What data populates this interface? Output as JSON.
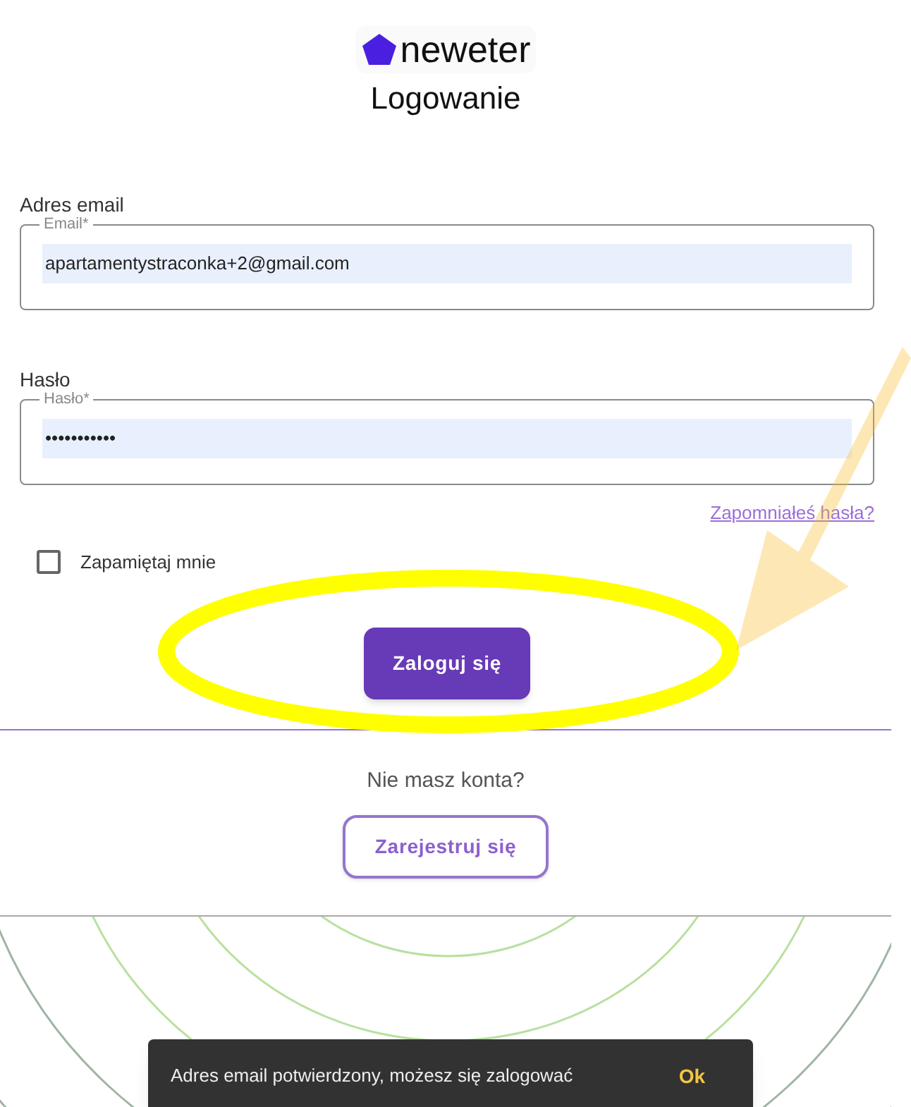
{
  "logo": {
    "text": "neweter"
  },
  "title": "Logowanie",
  "email": {
    "label": "Adres email",
    "floating_label": "Email*",
    "value": "apartamentystraconka+2@gmail.com"
  },
  "password": {
    "label": "Hasło",
    "floating_label": "Hasło*",
    "value": "•••••••••••"
  },
  "forgot_link": "Zapomniałeś hasła?",
  "remember": {
    "label": "Zapamiętaj mnie",
    "checked": false
  },
  "login_button": "Zaloguj się",
  "register_prompt": "Nie masz konta?",
  "register_button": "Zarejestruj się",
  "snackbar": {
    "message": "Adres email potwierdzony, możesz się zalogować",
    "action": "Ok"
  }
}
